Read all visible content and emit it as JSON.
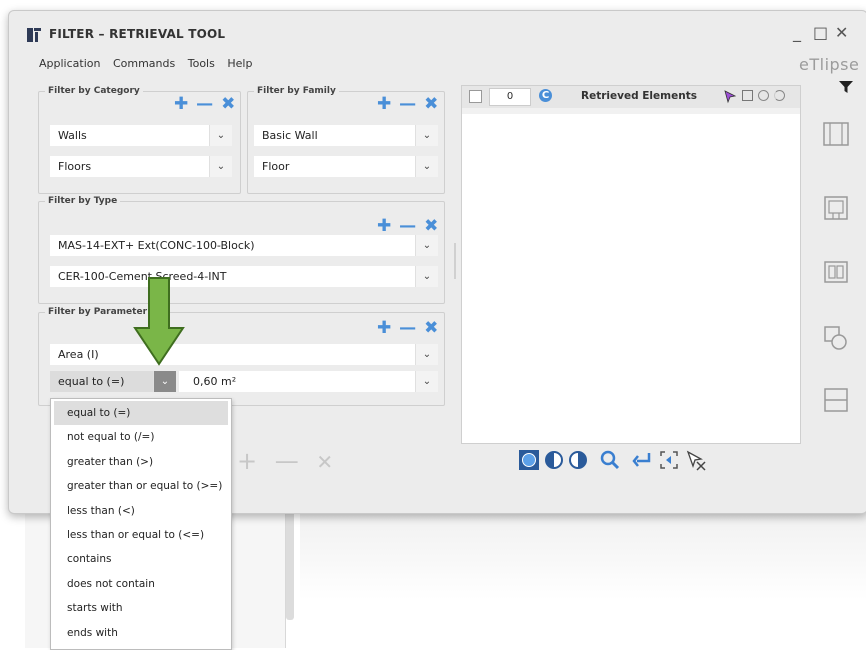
{
  "window": {
    "title": "FILTER – RETRIEVAL TOOL",
    "brand": "eTlipse",
    "controls": {
      "minimize": "_",
      "maximize": "□",
      "close": "✕"
    }
  },
  "menu": [
    "Application",
    "Commands",
    "Tools",
    "Help"
  ],
  "filter_category": {
    "title": "Filter by Category",
    "rows": [
      {
        "value": "Walls"
      },
      {
        "value": "Floors"
      }
    ]
  },
  "filter_family": {
    "title": "Filter by Family",
    "rows": [
      {
        "value": "Basic Wall"
      },
      {
        "value": "Floor"
      }
    ]
  },
  "filter_type": {
    "title": "Filter by Type",
    "rows": [
      {
        "value": "MAS-14-EXT+ Ext(CONC-100-Block)"
      },
      {
        "value": "CER-100-Cement Screed-4-INT"
      }
    ]
  },
  "filter_parameter": {
    "title": "Filter by Parameter",
    "parameter": "Area (I)",
    "operator": "equal to (=)",
    "value": "0,60 m²"
  },
  "retrieved": {
    "count": "0",
    "title": "Retrieved Elements"
  },
  "operator_options": [
    "equal to (=)",
    "not equal to (/=)",
    "greater than (>)",
    "greater than or equal to (>=)",
    "less than (<)",
    "less than or equal to (<=)",
    "contains",
    "does not contain",
    "starts with",
    "ends with"
  ],
  "colors": {
    "accent": "#4a8fd8",
    "arrow_green": "#7ab648",
    "window_bg": "#ececec"
  }
}
